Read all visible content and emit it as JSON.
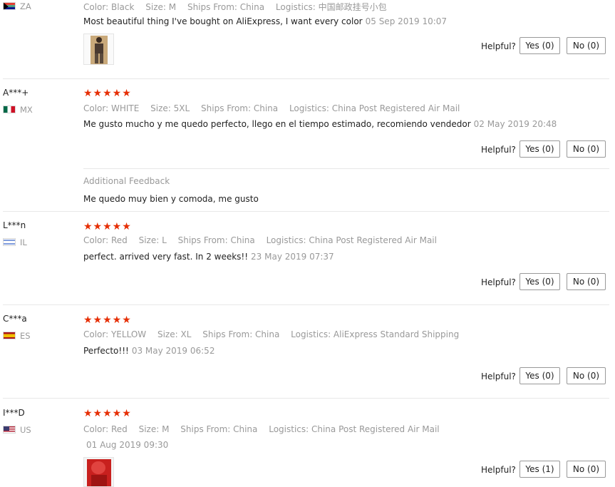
{
  "helpful_label": "Helpful?",
  "accent_color": "#e62e04",
  "reviews": [
    {
      "country_code": "ZA",
      "flag_icon": "za-flag-icon",
      "meta": {
        "color": "Color: Black",
        "size": "Size: M",
        "ships": "Ships From: China",
        "logistics": "Logistics: 中国邮政挂号小包"
      },
      "text": "Most beautiful thing I've bought on AliExpress, I want every color",
      "date": "05 Sep 2019 10:07",
      "yes": "Yes (0)",
      "no": "No (0)",
      "has_photo": true
    },
    {
      "user": "A***+",
      "country_code": "MX",
      "flag_icon": "mx-flag-icon",
      "stars": "★★★★★",
      "rating": 5,
      "meta": {
        "color": "Color: WHITE",
        "size": "Size: 5XL",
        "ships": "Ships From: China",
        "logistics": "Logistics: China Post Registered Air Mail"
      },
      "text": "Me gusto mucho y me quedo perfecto, llego en el tiempo estimado, recomiendo vendedor",
      "date": "02 May 2019 20:48",
      "yes": "Yes (0)",
      "no": "No (0)",
      "additional_feedback_title": "Additional Feedback",
      "additional_feedback_text": "Me quedo muy bien y comoda, me gusto"
    },
    {
      "user": "L***n",
      "country_code": "IL",
      "flag_icon": "il-flag-icon",
      "stars": "★★★★★",
      "rating": 5,
      "meta": {
        "color": "Color: Red",
        "size": "Size: L",
        "ships": "Ships From: China",
        "logistics": "Logistics: China Post Registered Air Mail"
      },
      "text": "perfect. arrived very fast. In 2 weeks!!",
      "date": "23 May 2019 07:37",
      "yes": "Yes (0)",
      "no": "No (0)"
    },
    {
      "user": "C***a",
      "country_code": "ES",
      "flag_icon": "es-flag-icon",
      "stars": "★★★★★",
      "rating": 5,
      "meta": {
        "color": "Color: YELLOW",
        "size": "Size: XL",
        "ships": "Ships From: China",
        "logistics": "Logistics: AliExpress Standard Shipping"
      },
      "text": "Perfecto!!!",
      "date": "03 May 2019 06:52",
      "yes": "Yes (0)",
      "no": "No (0)"
    },
    {
      "user": "I***D",
      "country_code": "US",
      "flag_icon": "us-flag-icon",
      "stars": "★★★★★",
      "rating": 5,
      "meta": {
        "color": "Color: Red",
        "size": "Size: M",
        "ships": "Ships From: China",
        "logistics": "Logistics: China Post Registered Air Mail"
      },
      "text": "",
      "date": "01 Aug 2019 09:30",
      "yes": "Yes (1)",
      "no": "No (0)",
      "has_photo": true
    }
  ]
}
